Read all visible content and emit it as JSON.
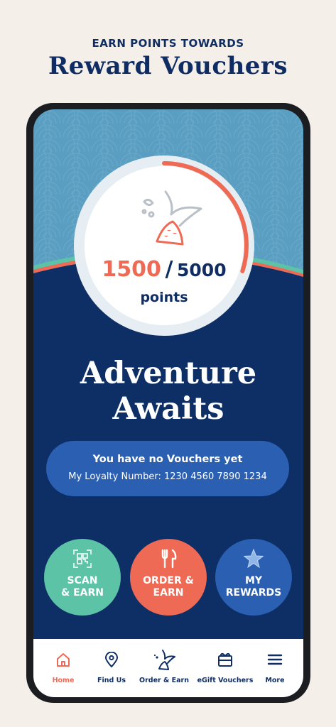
{
  "promo": {
    "subtitle": "EARN POINTS TOWARDS",
    "title": "Reward Vouchers"
  },
  "points": {
    "current": "1500",
    "separator": "/",
    "total": "5000",
    "label": "points",
    "progress_fraction": 0.3
  },
  "headline": {
    "line1": "Adventure",
    "line2": "Awaits"
  },
  "vouchers": {
    "title": "You have no Vouchers yet",
    "loyalty_number": "My Loyalty Number: 1230 4560 7890 1234"
  },
  "actions": [
    {
      "label": "SCAN\n& EARN",
      "icon": "qr-code-icon",
      "color": "#5cc3a6"
    },
    {
      "label": "ORDER &\nEARN",
      "icon": "fork-knife-icon",
      "color": "#ef6a55"
    },
    {
      "label": "MY\nREWARDS",
      "icon": "starfish-icon",
      "color": "#2b5fb2"
    }
  ],
  "nav": {
    "items": [
      {
        "label": "Home",
        "icon": "home-icon",
        "active": true
      },
      {
        "label": "Find Us",
        "icon": "location-pin-icon",
        "active": false
      },
      {
        "label": "Order & Earn",
        "icon": "mermaid-tail-icon",
        "active": false
      },
      {
        "label": "eGift Vouchers",
        "icon": "gift-card-icon",
        "active": false
      },
      {
        "label": "More",
        "icon": "menu-icon",
        "active": false
      }
    ]
  },
  "colors": {
    "navy": "#0f2d63",
    "coral": "#ef6a55",
    "teal": "#5cc3a6",
    "sky": "#5a9ec2",
    "blue": "#2b5fb2"
  }
}
